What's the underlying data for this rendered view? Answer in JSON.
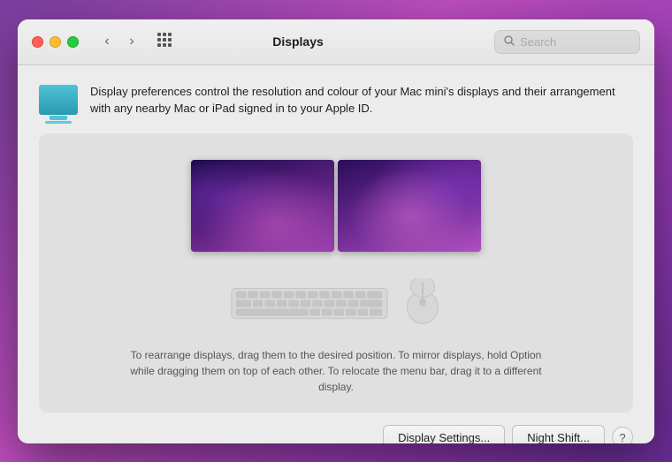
{
  "window": {
    "title": "Displays"
  },
  "titlebar": {
    "back_label": "‹",
    "forward_label": "›",
    "grid_label": "⊞",
    "title": "Displays",
    "search_placeholder": "Search"
  },
  "info": {
    "description": "Display preferences control the resolution and colour of your Mac mini's displays and their arrangement with any nearby Mac or iPad signed in to your Apple ID."
  },
  "displays_area": {
    "instruction_text": "To rearrange displays, drag them to the desired position. To mirror displays, hold Option while dragging them on top of each other. To relocate the menu bar, drag it to a different display."
  },
  "buttons": {
    "display_settings_label": "Display Settings...",
    "night_shift_label": "Night Shift...",
    "help_label": "?"
  }
}
